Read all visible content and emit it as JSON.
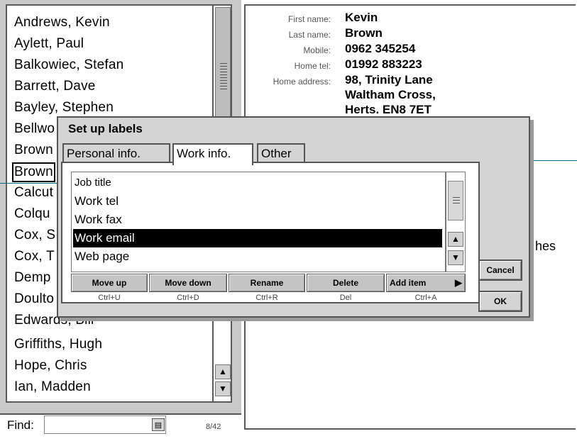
{
  "contacts": [
    "Andrews, Kevin",
    "Aylett, Paul",
    "Balkowiec, Stefan",
    "Barrett, Dave",
    "Bayley, Stephen",
    "Bellwo",
    "Brown",
    "Brown",
    "Calcut",
    "Colqu",
    "Cox, S",
    "Cox, T",
    "Demp",
    "Doulto",
    "Edwards, Bill",
    "Griffiths, Hugh",
    "Hope, Chris",
    "Ian, Madden"
  ],
  "selected_contact_index": 7,
  "find": {
    "label": "Find:",
    "value": "",
    "count": "8/42"
  },
  "details": {
    "first_name_label": "First name:",
    "first_name": "Kevin",
    "last_name_label": "Last name:",
    "last_name": "Brown",
    "mobile_label": "Mobile:",
    "mobile": "0962 345254",
    "home_tel_label": "Home tel:",
    "home_tel": "01992 883223",
    "home_address_label": "Home address:",
    "home_address_1": "98, Trinity Lane",
    "home_address_2": "Waltham Cross,",
    "home_address_3": "Herts.  EN8 7ET",
    "partial_text": "hes"
  },
  "dialog": {
    "title": "Set up labels",
    "tabs": [
      "Personal info.",
      "Work info.",
      "Other"
    ],
    "active_tab": "Work info.",
    "items": [
      "Job title",
      "Work tel",
      "Work fax",
      "Work email",
      "Web page"
    ],
    "selected_item": "Work email",
    "buttons": [
      {
        "label": "Move up",
        "shortcut": "Ctrl+U"
      },
      {
        "label": "Move down",
        "shortcut": "Ctrl+D"
      },
      {
        "label": "Rename",
        "shortcut": "Ctrl+R"
      },
      {
        "label": "Delete",
        "shortcut": "Del"
      },
      {
        "label": "Add item",
        "shortcut": "Ctrl+A"
      }
    ],
    "cancel_label": "Cancel",
    "ok_label": "OK"
  },
  "colors": {
    "callout_line": "#006c8a",
    "selection": "#000000"
  }
}
